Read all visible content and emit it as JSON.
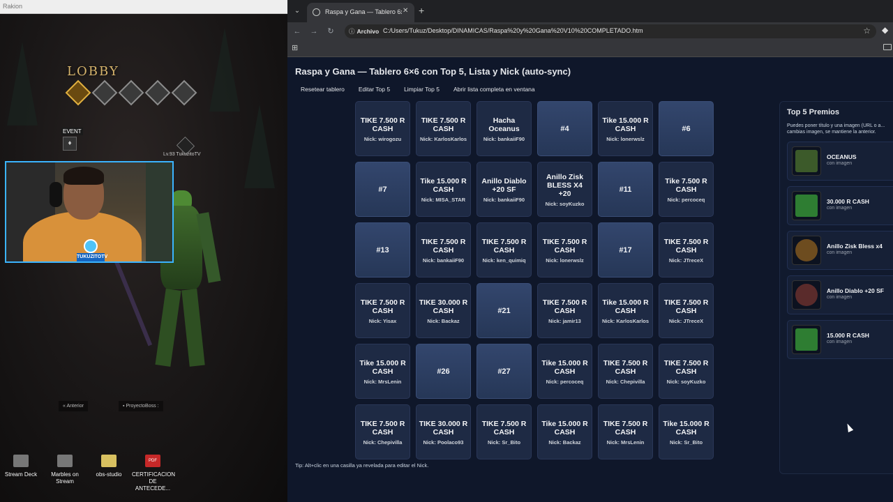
{
  "game": {
    "window_title": "Rakion",
    "lobby_title": "LOBBY",
    "event_label": "EVENT",
    "player_tag": "Lv.93 TukuzitoTV",
    "streamer_logo_text": "TUKUZITOTV",
    "bottom_bar": [
      "Anterior",
      "ProyectoBoss :"
    ]
  },
  "desktop": {
    "icons": [
      {
        "label": "Stream Deck",
        "icon": "stream-deck-icon"
      },
      {
        "label": "Marbles on Stream",
        "icon": "marbles-icon"
      },
      {
        "label": "obs-studio",
        "icon": "folder-icon"
      },
      {
        "label": "CERTIFICACION DE ANTECEDE...",
        "icon": "pdf-icon",
        "badge": "PDF"
      }
    ]
  },
  "browser": {
    "tab_title": "Raspa y Gana — Tablero 6x6 +",
    "chip": "Archivo",
    "url": "C:/Users/Tukuz/Desktop/DINAMICAS/Raspa%20y%20Gana%20V10%20COMPLETADO.htm",
    "nav_icons": {
      "back": "←",
      "forward": "→",
      "reload": "↻",
      "star": "☆",
      "apps": "⊞",
      "tab_menu": "⌄",
      "close": "✕",
      "new_tab": "+",
      "extension": "◆"
    }
  },
  "page": {
    "title": "Raspa y Gana — Tablero 6×6 con Top 5, Lista y Nick (auto-sync)",
    "actions": [
      "Resetear tablero",
      "Editar Top 5",
      "Limpiar Top 5",
      "Abrir lista completa en ventana"
    ],
    "tip": "Tip: Alt+clic en una casilla ya revelada para editar el Nick.",
    "cells": [
      {
        "prize": "TIKE 7.500 R CASH",
        "nick": "Nick: wirogozu"
      },
      {
        "prize": "TIKE 7.500 R CASH",
        "nick": "Nick: KarlosKarlos"
      },
      {
        "prize": "Hacha Oceanus",
        "nick": "Nick: bankaiiF90"
      },
      {
        "hidden": "#4"
      },
      {
        "prize": "Tike 15.000 R CASH",
        "nick": "Nick: lonerwslz"
      },
      {
        "hidden": "#6"
      },
      {
        "hidden": "#7"
      },
      {
        "prize": "Tike 15.000 R CASH",
        "nick": "Nick: MISA_STAR"
      },
      {
        "prize": "Anillo Diablo +20 SF",
        "nick": "Nick: bankaiiF90"
      },
      {
        "prize": "Anillo Zisk BLESS X4 +20",
        "nick": "Nick: soyKuzko"
      },
      {
        "hidden": "#11"
      },
      {
        "prize": "Tike 7.500 R CASH",
        "nick": "Nick: percoceq"
      },
      {
        "hidden": "#13"
      },
      {
        "prize": "TIKE 7.500 R CASH",
        "nick": "Nick: bankaiiF90"
      },
      {
        "prize": "TIKE 7.500 R CASH",
        "nick": "Nick: ken_quimiq"
      },
      {
        "prize": "TIKE 7.500 R CASH",
        "nick": "Nick: lonerwslz"
      },
      {
        "hidden": "#17"
      },
      {
        "prize": "TIKE 7.500 R CASH",
        "nick": "Nick: JTreceX"
      },
      {
        "prize": "TIKE 7.500 R CASH",
        "nick": "Nick: Yisax"
      },
      {
        "prize": "TIKE 30.000 R CASH",
        "nick": "Nick: Backaz"
      },
      {
        "hidden": "#21"
      },
      {
        "prize": "TIKE 7.500 R CASH",
        "nick": "Nick: jamir13"
      },
      {
        "prize": "Tike 15.000 R CASH",
        "nick": "Nick: KarlosKarlos"
      },
      {
        "prize": "TIKE 7.500 R CASH",
        "nick": "Nick: JTreceX"
      },
      {
        "prize": "Tike 15.000 R CASH",
        "nick": "Nick: MrsLenin"
      },
      {
        "hidden": "#26"
      },
      {
        "hidden": "#27"
      },
      {
        "prize": "Tike 15.000 R CASH",
        "nick": "Nick: percoceq"
      },
      {
        "prize": "TIKE 7.500 R CASH",
        "nick": "Nick: Chepivilla"
      },
      {
        "prize": "TIKE 7.500 R CASH",
        "nick": "Nick: soyKuzko"
      },
      {
        "prize": "TIKE 7.500 R CASH",
        "nick": "Nick: Chepivilla"
      },
      {
        "prize": "TIKE 30.000 R CASH",
        "nick": "Nick: Poolaco93"
      },
      {
        "prize": "TIKE 7.500 R CASH",
        "nick": "Nick: Sr_Bito"
      },
      {
        "prize": "Tike 15.000 R CASH",
        "nick": "Nick: Backaz"
      },
      {
        "prize": "TIKE 7.500 R CASH",
        "nick": "Nick: MrsLenin"
      },
      {
        "prize": "Tike 15.000 R CASH",
        "nick": "Nick: Sr_Bito"
      }
    ],
    "top5": {
      "title": "Top 5 Premios",
      "description": "Puedes poner título y una imagen (URL o a... cambias imagen, se mantiene la anterior.",
      "items": [
        {
          "name": "OCEANUS",
          "sub": "con imagen",
          "thumb_color": "#3c5a2a"
        },
        {
          "name": "30.000 R CASH",
          "sub": "con imagen",
          "thumb_color": "#2e7d32"
        },
        {
          "name": "Anillo Zisk Bless x4",
          "sub": "con imagen",
          "thumb_color": "#6d4c1f"
        },
        {
          "name": "Anillo Diablo +20 SF",
          "sub": "con imagen",
          "thumb_color": "#5a2b2b"
        },
        {
          "name": "15.000 R CASH",
          "sub": "con imagen",
          "thumb_color": "#2e7d32"
        }
      ]
    }
  }
}
